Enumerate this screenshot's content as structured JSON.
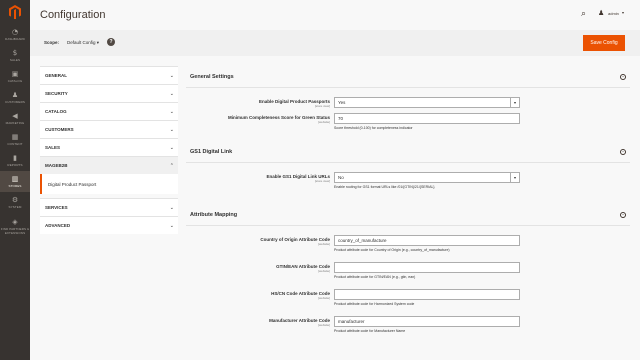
{
  "nav": {
    "items": [
      {
        "label": "DASHBOARD",
        "icon": "speedometer-icon",
        "glyph": "◔",
        "active": false
      },
      {
        "label": "SALES",
        "icon": "dollar-icon",
        "glyph": "$",
        "active": false
      },
      {
        "label": "CATALOG",
        "icon": "cube-icon",
        "glyph": "▣",
        "active": false
      },
      {
        "label": "CUSTOMERS",
        "icon": "person-icon",
        "glyph": "♟",
        "active": false
      },
      {
        "label": "MARKETING",
        "icon": "megaphone-icon",
        "glyph": "◀",
        "active": false
      },
      {
        "label": "CONTENT",
        "icon": "layout-icon",
        "glyph": "▦",
        "active": false
      },
      {
        "label": "REPORTS",
        "icon": "bar-chart-icon",
        "glyph": "▮",
        "active": false
      },
      {
        "label": "STORES",
        "icon": "store-icon",
        "glyph": "▥",
        "active": true
      },
      {
        "label": "SYSTEM",
        "icon": "gear-icon",
        "glyph": "⚙",
        "active": false
      },
      {
        "label": "FIND PARTNERS & EXTENSIONS",
        "icon": "puzzle-icon",
        "glyph": "◈",
        "active": false
      }
    ]
  },
  "header": {
    "title": "Configuration",
    "user": "admin",
    "search_icon": "⌕",
    "user_icon": "♟"
  },
  "scope": {
    "label": "Scope:",
    "value": "Default Config",
    "help": "?",
    "save_label": "Save Config"
  },
  "tabs": [
    {
      "label": "GENERAL",
      "state": "closed"
    },
    {
      "label": "SECURITY",
      "state": "closed"
    },
    {
      "label": "CATALOG",
      "state": "closed"
    },
    {
      "label": "CUSTOMERS",
      "state": "closed"
    },
    {
      "label": "SALES",
      "state": "closed"
    },
    {
      "label": "MAGEB2B",
      "state": "open",
      "children": [
        "Digital Product Passport"
      ]
    },
    {
      "label": "SERVICES",
      "state": "closed"
    },
    {
      "label": "ADVANCED",
      "state": "closed"
    }
  ],
  "sections": [
    {
      "title": "General Settings",
      "fields": [
        {
          "label": "Enable Digital Product Passports",
          "scope": "[store view]",
          "type": "select",
          "value": "Yes",
          "note": ""
        },
        {
          "label": "Minimum Completeness Score for Green Status",
          "scope": "[website]",
          "type": "text",
          "value": "70",
          "note": "Score threshold (0-100) for completeness indicator"
        }
      ]
    },
    {
      "title": "GS1 Digital Link",
      "fields": [
        {
          "label": "Enable GS1 Digital Link URLs",
          "scope": "[store view]",
          "type": "select",
          "value": "No",
          "note": "Enable routing for GS1 format URLs like /01/{GTIN}/21/{SERIAL}"
        }
      ]
    },
    {
      "title": "Attribute Mapping",
      "fields": [
        {
          "label": "Country of Origin Attribute Code",
          "scope": "[website]",
          "type": "text",
          "value": "country_of_manufacture",
          "note": "Product attribute code for Country of Origin (e.g., country_of_manufacture)"
        },
        {
          "label": "GTIN/EAN Attribute Code",
          "scope": "[website]",
          "type": "text",
          "value": "",
          "note": "Product attribute code for GTIN/EAN (e.g., gtin, ean)"
        },
        {
          "label": "HS/CN Code Attribute Code",
          "scope": "[website]",
          "type": "text",
          "value": "",
          "note": "Product attribute code for Harmonized System code"
        },
        {
          "label": "Manufacturer Attribute Code",
          "scope": "[website]",
          "type": "text",
          "value": "manufacturer",
          "note": "Product attribute code for Manufacturer Name"
        }
      ]
    }
  ],
  "colors": {
    "accent": "#eb5202",
    "nav_bg": "#373330",
    "nav_active": "#514943"
  }
}
